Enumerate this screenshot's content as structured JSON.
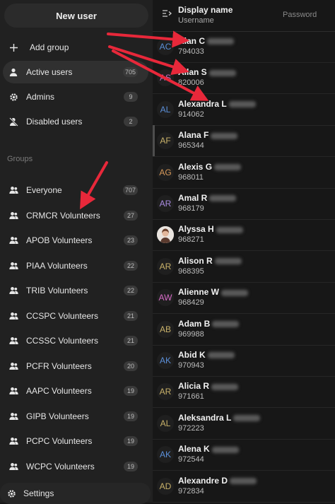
{
  "sidebar": {
    "new_user_label": "New user",
    "add_group_label": "Add group",
    "nav": [
      {
        "label": "Active users",
        "count": "705",
        "icon": "user-icon",
        "active": true
      },
      {
        "label": "Admins",
        "count": "9",
        "icon": "gear-icon",
        "active": false
      },
      {
        "label": "Disabled users",
        "count": "2",
        "icon": "disabled-user-icon",
        "active": false
      }
    ],
    "groups_heading": "Groups",
    "groups": [
      {
        "label": "Everyone",
        "count": "707"
      },
      {
        "label": "CRMCR Volunteers",
        "count": "27"
      },
      {
        "label": "APOB Volunteers",
        "count": "23"
      },
      {
        "label": "PIAA Volunteers",
        "count": "22"
      },
      {
        "label": "TRIB Volunteers",
        "count": "22"
      },
      {
        "label": "CCSPC Volunteers",
        "count": "21"
      },
      {
        "label": "CCSSC Volunteers",
        "count": "21"
      },
      {
        "label": "PCFR Volunteers",
        "count": "20"
      },
      {
        "label": "AAPC Volunteers",
        "count": "19"
      },
      {
        "label": "GIPB Volunteers",
        "count": "19"
      },
      {
        "label": "PCPC Volunteers",
        "count": "19"
      },
      {
        "label": "WCPC Volunteers",
        "count": "19"
      }
    ],
    "settings_label": "Settings"
  },
  "header": {
    "display_name": "Display name",
    "username": "Username",
    "password": "Password"
  },
  "users": [
    {
      "initials": "AC",
      "name": "Alan C",
      "id": "794033",
      "color": "#5b8fd8"
    },
    {
      "initials": "AS",
      "name": "Allan S",
      "id": "820006",
      "color": "#c86cc0"
    },
    {
      "initials": "AL",
      "name": "Alexandra L",
      "id": "914062",
      "color": "#5b8fd8"
    },
    {
      "initials": "AF",
      "name": "Alana F",
      "id": "965344",
      "color": "#c9b26a"
    },
    {
      "initials": "AG",
      "name": "Alexis G",
      "id": "968011",
      "color": "#d89a5a"
    },
    {
      "initials": "AR",
      "name": "Amal R",
      "id": "968179",
      "color": "#a98be0"
    },
    {
      "initials": "",
      "name": "Alyssa H",
      "id": "968271",
      "color": "#e9e4df"
    },
    {
      "initials": "AR",
      "name": "Alison R",
      "id": "968395",
      "color": "#c9b26a"
    },
    {
      "initials": "AW",
      "name": "Alienne W",
      "id": "968429",
      "color": "#d86cc8"
    },
    {
      "initials": "AB",
      "name": "Adam B",
      "id": "969988",
      "color": "#c9b26a"
    },
    {
      "initials": "AK",
      "name": "Abid K",
      "id": "970943",
      "color": "#5b8fd8"
    },
    {
      "initials": "AR",
      "name": "Alicia R",
      "id": "971661",
      "color": "#c9b26a"
    },
    {
      "initials": "AL",
      "name": "Aleksandra L",
      "id": "972223",
      "color": "#c9b26a"
    },
    {
      "initials": "AK",
      "name": "Alena K",
      "id": "972544",
      "color": "#5b8fd8"
    },
    {
      "initials": "AD",
      "name": "Alexandre D",
      "id": "972834",
      "color": "#c9b26a"
    }
  ]
}
